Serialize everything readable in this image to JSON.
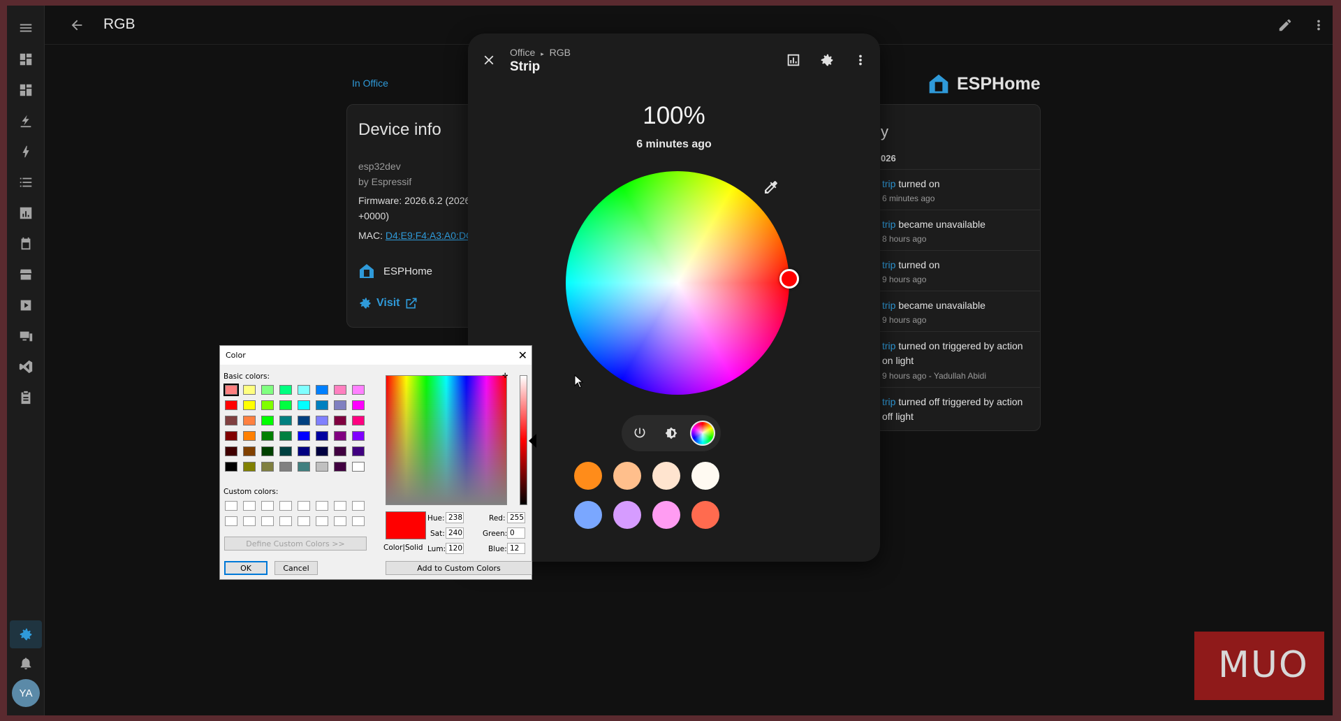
{
  "topbar": {
    "title": "RGB"
  },
  "sidebar": {
    "avatar_initials": "YA"
  },
  "page": {
    "area_link": "In Office",
    "device_info": {
      "heading": "Device info",
      "model": "esp32dev",
      "manufacturer": "by Espressif",
      "firmware_line1": "Firmware: 2026.6.2 (2026",
      "firmware_line2": "+0000)",
      "mac_label": "MAC: ",
      "mac_value": "D4:E9:F4:A3:A0:DC",
      "integration": "ESPHome",
      "visit": "Visit"
    },
    "brand": "ESPHome",
    "logbook": {
      "heading": "y",
      "date": "026",
      "entries": [
        {
          "entity": "trip",
          "action": " turned on",
          "when": "6 minutes ago"
        },
        {
          "entity": "trip",
          "action": " became unavailable",
          "when": "8 hours ago"
        },
        {
          "entity": "trip",
          "action": " turned on",
          "when": "9 hours ago"
        },
        {
          "entity": "trip",
          "action": " became unavailable",
          "when": "9 hours ago"
        },
        {
          "entity": "trip",
          "action": " turned on triggered by action on light",
          "when": "9 hours ago - Yadullah Abidi"
        },
        {
          "entity": "trip",
          "action": " turned off triggered by action off light",
          "when": ""
        }
      ]
    }
  },
  "dialog": {
    "breadcrumb_area": "Office",
    "breadcrumb_sep": "▸",
    "breadcrumb_device": "RGB",
    "title": "Strip",
    "brightness": "100%",
    "last_changed": "6 minutes ago",
    "selected_color": "#ff0000",
    "favorites": [
      "#ff8c1a",
      "#ffbf8c",
      "#ffe4cf",
      "#fffaf2",
      "#7aa7ff",
      "#d69cff",
      "#ff9cf2",
      "#ff6b4f"
    ]
  },
  "color_dialog": {
    "caption": "Color",
    "basic_label": "Basic colors:",
    "custom_label": "Custom colors:",
    "define_btn": "Define Custom Colors >>",
    "ok": "OK",
    "cancel": "Cancel",
    "add_btn": "Add to Custom Colors",
    "solid_label": "Color|Solid",
    "hue_label": "Hue:",
    "hue": "238",
    "sat_label": "Sat:",
    "sat": "240",
    "lum_label": "Lum:",
    "lum": "120",
    "red_label": "Red:",
    "red": "255",
    "green_label": "Green:",
    "green": "0",
    "blue_label": "Blue:",
    "blue": "12",
    "basic_colors": [
      "#ff8080",
      "#ffff80",
      "#80ff80",
      "#00ff80",
      "#80ffff",
      "#0080ff",
      "#ff80c0",
      "#ff80ff",
      "#ff0000",
      "#ffff00",
      "#80ff00",
      "#00ff40",
      "#00ffff",
      "#0080c0",
      "#8080c0",
      "#ff00ff",
      "#804040",
      "#ff8040",
      "#00ff00",
      "#008080",
      "#004080",
      "#8080ff",
      "#800040",
      "#ff0080",
      "#800000",
      "#ff8000",
      "#008000",
      "#008040",
      "#0000ff",
      "#0000a0",
      "#800080",
      "#8000ff",
      "#400000",
      "#804000",
      "#004000",
      "#004040",
      "#000080",
      "#000040",
      "#400040",
      "#400080",
      "#000000",
      "#808000",
      "#808040",
      "#808080",
      "#408080",
      "#c0c0c0",
      "#400040",
      "#ffffff"
    ]
  },
  "watermark": "MUO"
}
